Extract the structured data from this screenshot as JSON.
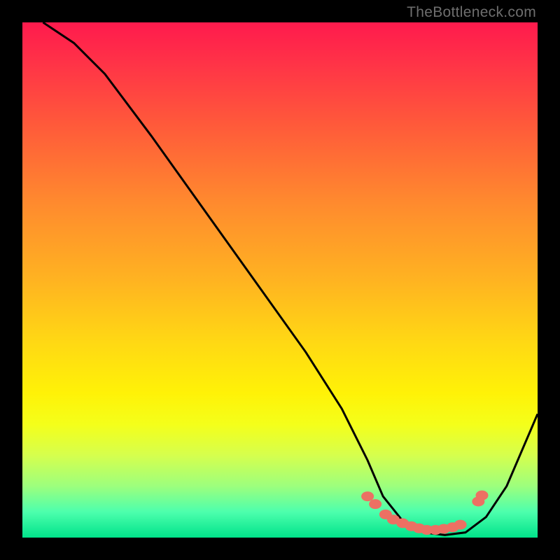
{
  "watermark": "TheBottleneck.com",
  "colors": {
    "dot_fill": "#ec7063",
    "curve_stroke": "#000000"
  },
  "chart_data": {
    "type": "line",
    "title": "",
    "xlabel": "",
    "ylabel": "",
    "xlim": [
      0,
      100
    ],
    "ylim": [
      0,
      100
    ],
    "notes": "Single-series valley curve on a red-to-green gradient background. No axis tick labels present in image; y=100 is top (red/bad), y≈0 is bottom (green/good). The curve falls steeply from upper-left, bottoms out around x≈70–90, then rises toward the right edge. A cluster of salmon dots sits inside the valley.",
    "series": [
      {
        "name": "curve",
        "x": [
          4,
          10,
          16,
          25,
          35,
          45,
          55,
          62,
          67,
          70,
          74,
          78,
          82,
          86,
          90,
          94,
          100
        ],
        "y": [
          100,
          96,
          90,
          78,
          64,
          50,
          36,
          25,
          15,
          8,
          3,
          1,
          0.5,
          1,
          4,
          10,
          24
        ]
      }
    ],
    "valley_dots": {
      "x": [
        67,
        68.5,
        70.5,
        72,
        73.8,
        75.5,
        77,
        78.5,
        80.2,
        81.8,
        83.5,
        85,
        88.5,
        89.2
      ],
      "y": [
        8,
        6.5,
        4.5,
        3.5,
        2.8,
        2.2,
        1.8,
        1.5,
        1.5,
        1.7,
        2.0,
        2.5,
        7,
        8.2
      ]
    }
  }
}
